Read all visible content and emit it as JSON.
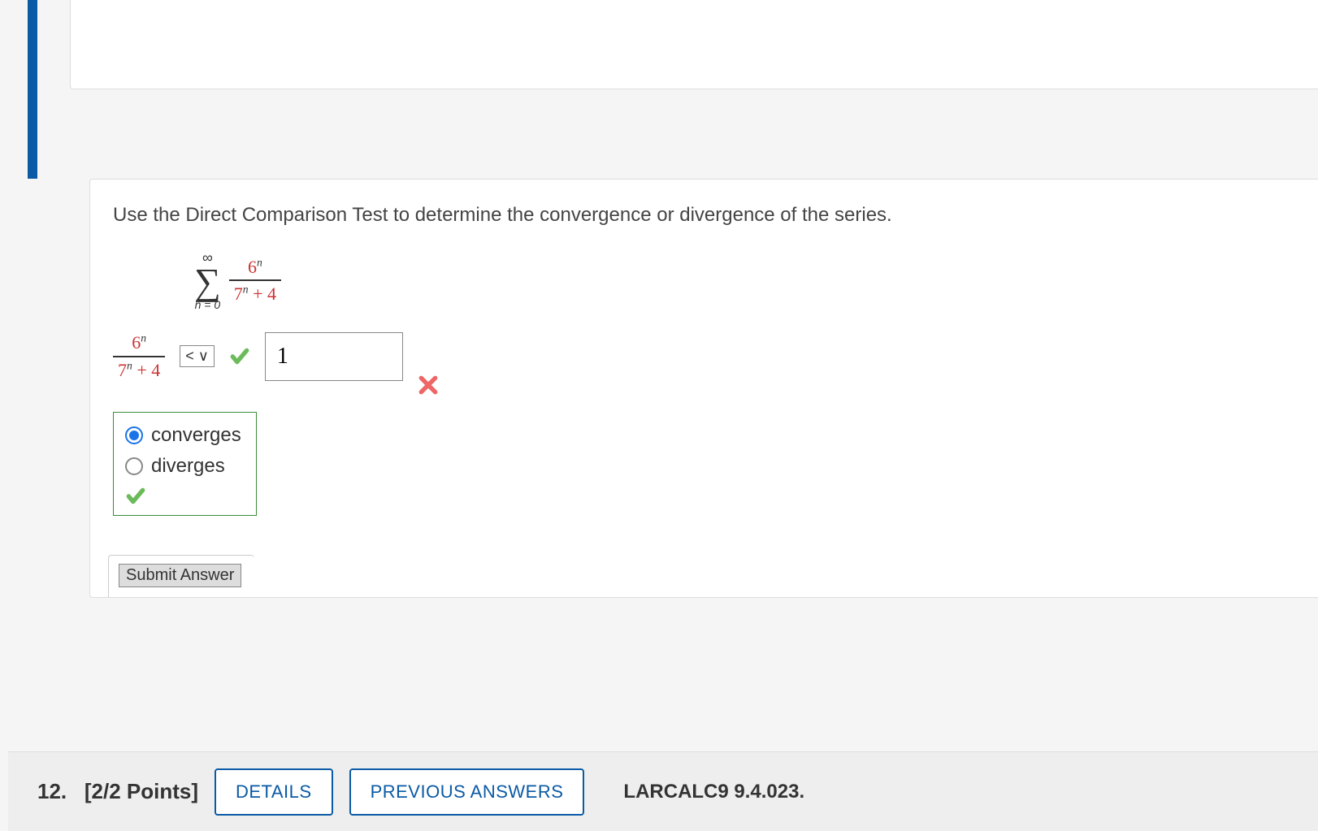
{
  "question": {
    "prompt": "Use the Direct Comparison Test to determine the convergence or divergence of the series.",
    "series": {
      "upper": "∞",
      "lower": "n = 0",
      "numerator_base": "6",
      "numerator_exp": "n",
      "denominator_base": "7",
      "denominator_exp": "n",
      "denominator_plus": " + 4"
    },
    "comparison": {
      "numerator_base": "6",
      "numerator_exp": "n",
      "denominator_base": "7",
      "denominator_exp": "n",
      "denominator_plus": " + 4",
      "operator": "< ∨",
      "operator_correct": true,
      "input_value": "1",
      "input_correct": false
    },
    "choices": {
      "options": [
        "converges",
        "diverges"
      ],
      "selected": "converges",
      "correct": true
    },
    "submit_label": "Submit Answer"
  },
  "next_question": {
    "number": "12.",
    "points": "[2/2 Points]",
    "details_label": "DETAILS",
    "previous_label": "PREVIOUS ANSWERS",
    "reference": "LARCALC9 9.4.023."
  }
}
